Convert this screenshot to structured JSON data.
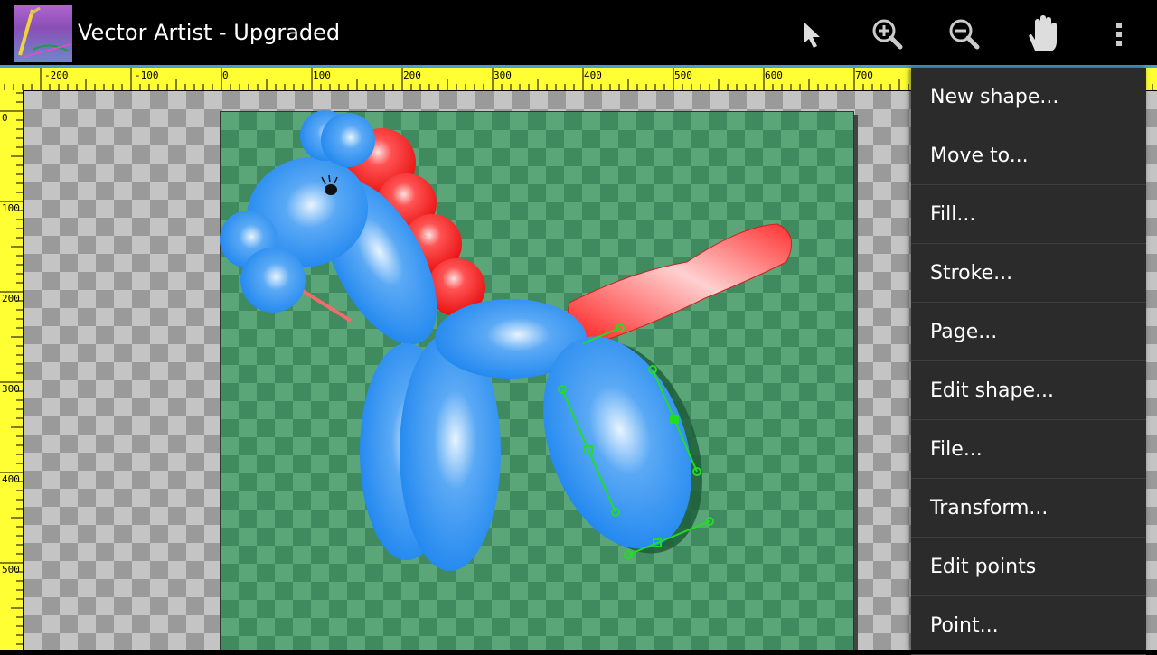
{
  "app": {
    "title": "Vector Artist - Upgraded",
    "icon": "app-pen-icon"
  },
  "toolbar": {
    "actions": [
      {
        "name": "select-tool",
        "icon": "arrow-pointer-icon"
      },
      {
        "name": "zoom-in",
        "icon": "zoom-in-icon"
      },
      {
        "name": "zoom-out",
        "icon": "zoom-out-icon"
      },
      {
        "name": "pan-tool",
        "icon": "hand-icon"
      },
      {
        "name": "overflow-menu",
        "icon": "more-vert-icon"
      }
    ]
  },
  "ruler": {
    "top_labels": [
      "-200",
      "-100",
      "0",
      "100",
      "200",
      "300",
      "400",
      "500",
      "600",
      "700"
    ],
    "left_labels": [
      "0",
      "100",
      "200",
      "300",
      "400",
      "500"
    ]
  },
  "menu": {
    "items": [
      "New shape...",
      "Move to...",
      "Fill...",
      "Stroke...",
      "Page...",
      "Edit shape...",
      "File...",
      "Transform...",
      "Edit points",
      "Point..."
    ]
  },
  "colors": {
    "actionbar": "#000000",
    "accent": "#3ea0d3",
    "ruler": "#ffff33",
    "menu_bg": "#2b2b2b",
    "balloon_blue": "#2b8ff0",
    "balloon_red": "#ff2a2a",
    "selection_green": "#22dd22"
  }
}
